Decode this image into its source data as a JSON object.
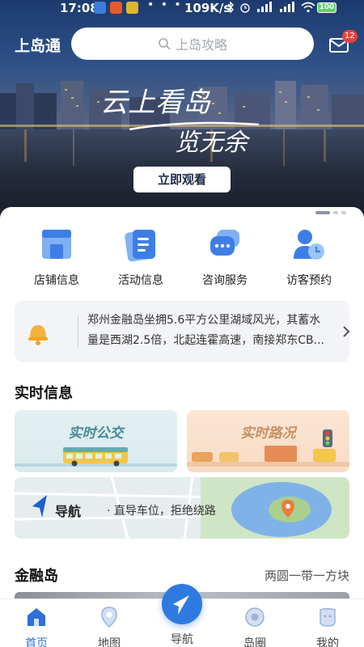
{
  "status_bar": {
    "time": "17:08",
    "network_speed": "109K/s",
    "battery": "100"
  },
  "header": {
    "brand": "上岛通",
    "search_placeholder": "上岛攻略",
    "mail_badge": "12"
  },
  "banner": {
    "calligraphy_line1": "云上看岛",
    "calligraphy_line2": "览无余",
    "watch_button": "立即观看"
  },
  "quick_actions": [
    {
      "label": "店铺信息",
      "icon": "shop-icon"
    },
    {
      "label": "活动信息",
      "icon": "event-list-icon"
    },
    {
      "label": "咨询服务",
      "icon": "chat-icon"
    },
    {
      "label": "访客预约",
      "icon": "visitor-clock-icon"
    }
  ],
  "notice": {
    "text": "郑州金融岛坐拥5.6平方公里湖域风光，其蓄水量是西湖2.5倍，北起连霍高速，南接郑东CB..."
  },
  "realtime": {
    "title": "实时信息",
    "bus_card": "实时公交",
    "road_card": "实时路况",
    "nav_label": "导航",
    "nav_sub": "· 直导车位，拒绝绕路"
  },
  "island": {
    "title": "金融岛",
    "subtitle": "两圆一带一方块"
  },
  "tabbar": [
    {
      "label": "首页",
      "active": true
    },
    {
      "label": "地图",
      "active": false
    },
    {
      "label": "导航",
      "active": false
    },
    {
      "label": "岛圈",
      "active": false
    },
    {
      "label": "我的",
      "active": false
    }
  ],
  "colors": {
    "accent": "#2f6fd6",
    "badge": "#e64340"
  }
}
